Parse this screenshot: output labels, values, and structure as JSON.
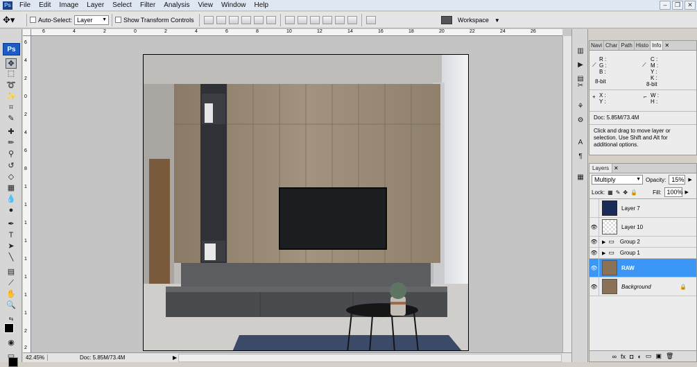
{
  "menu": [
    "File",
    "Edit",
    "Image",
    "Layer",
    "Select",
    "Filter",
    "Analysis",
    "View",
    "Window",
    "Help"
  ],
  "options": {
    "auto_select_label": "Auto-Select:",
    "auto_select_value": "Layer",
    "show_transform_label": "Show Transform Controls",
    "workspace_label": "Workspace"
  },
  "toolbox": {
    "logo": "Ps"
  },
  "rulers": {
    "top": [
      "6",
      "4",
      "2",
      "0",
      "2",
      "4",
      "6",
      "8",
      "10",
      "12",
      "14",
      "16",
      "18",
      "20",
      "22",
      "24",
      "26"
    ],
    "left": [
      "6",
      "4",
      "2",
      "0",
      "2",
      "4",
      "6",
      "8",
      "1",
      "1",
      "1",
      "1",
      "1",
      "1",
      "1",
      "1",
      "2",
      "2"
    ]
  },
  "status": {
    "zoom": "42.45%",
    "doc": "Doc: 5.85M/73.4M"
  },
  "info_panel": {
    "tabs": [
      "Navi",
      "Char",
      "Path",
      "Histo",
      "Info"
    ],
    "r": "R :",
    "g": "G :",
    "b": "B :",
    "c": "C :",
    "m": "M :",
    "y": "Y :",
    "k": "K :",
    "bit_left": "8-bit",
    "bit_right": "8-bit",
    "x": "X :",
    "y2": "Y :",
    "w": "W :",
    "h": "H :",
    "doc": "Doc: 5.85M/73.4M",
    "message": "Click and drag to move layer or selection. Use Shift and Alt for additional options."
  },
  "layers_panel": {
    "tab": "Layers",
    "blend_mode": "Multiply",
    "opacity_label": "Opacity:",
    "opacity_value": "15%",
    "lock_label": "Lock:",
    "fill_label": "Fill:",
    "fill_value": "100%",
    "layers": [
      {
        "name": "Layer 7",
        "visible": false
      },
      {
        "name": "Layer 10",
        "visible": true
      },
      {
        "name": "Group 2",
        "visible": true,
        "group": true
      },
      {
        "name": "Group 1",
        "visible": true,
        "group": true
      },
      {
        "name": "RAW",
        "visible": true,
        "selected": true
      },
      {
        "name": "Background",
        "visible": true,
        "locked": true
      }
    ]
  }
}
